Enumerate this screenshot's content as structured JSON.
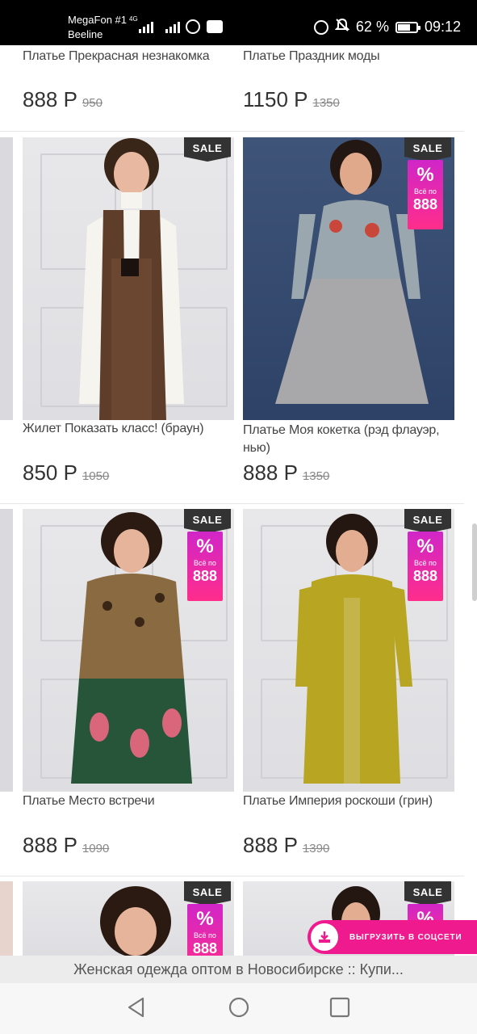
{
  "status": {
    "carrier1": "MegaFon #1",
    "carrier2": "Beeline",
    "network": "4G",
    "battery": "62 %",
    "battery_level": 0.62,
    "time": "09:12"
  },
  "products": [
    {
      "name": "Платье Прекрасная незнакомка",
      "price": "888 Р",
      "old_price": "950"
    },
    {
      "name": "Платье Праздник моды",
      "price": "1150 Р",
      "old_price": "1350"
    },
    {
      "name": "Жилет Показать класс! (браун)",
      "price": "850 Р",
      "old_price": "1050",
      "sale": "SALE"
    },
    {
      "name": "Платье Моя кокетка (рэд флауэр, нью)",
      "price": "888 Р",
      "old_price": "1350",
      "sale": "SALE",
      "promo": {
        "pct": "%",
        "line1": "Всё по",
        "line2": "888"
      }
    },
    {
      "name": "Платье Место встречи",
      "price": "888 Р",
      "old_price": "1090",
      "sale": "SALE",
      "promo": {
        "pct": "%",
        "line1": "Всё по",
        "line2": "888"
      }
    },
    {
      "name": "Платье Империя роскоши (грин)",
      "price": "888 Р",
      "old_price": "1390",
      "sale": "SALE",
      "promo": {
        "pct": "%",
        "line1": "Всё по",
        "line2": "888"
      }
    },
    {
      "sale": "SALE",
      "promo": {
        "pct": "%",
        "line1": "Всё по",
        "line2": "888"
      }
    },
    {
      "sale": "SALE",
      "promo": {
        "pct": "%"
      }
    }
  ],
  "fab": {
    "label": "ВЫГРУЗИТЬ В СОЦСЕТИ",
    "icon": "download-icon"
  },
  "browser": {
    "page_title": "Женская одежда оптом в Новосибирске :: Купи..."
  },
  "colors": {
    "accent": "#f01a8f",
    "badge_from": "#d026c8",
    "badge_to": "#ff2d8b"
  }
}
